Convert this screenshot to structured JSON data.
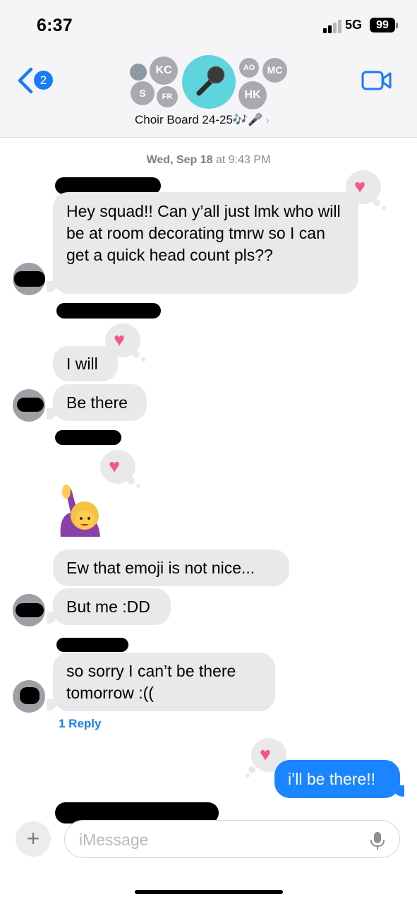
{
  "status_bar": {
    "time": "6:37",
    "network": "5G",
    "battery": "99"
  },
  "nav": {
    "back_badge": "2",
    "group_name": "Choir Board 24-25🎶🎤",
    "chevron": "›",
    "avatars": {
      "kc": "KC",
      "s": "S",
      "fr": "FR",
      "ao": "AO",
      "mc": "MC",
      "hk": "HK"
    }
  },
  "conversation": {
    "timestamp_day": "Wed, Sep 18",
    "timestamp_time": "at 9:43 PM",
    "messages": [
      {
        "text": "Hey squad!! Can y’all just lmk who will be at room decorating tmrw so I can get a quick head count pls??"
      },
      {
        "text": "I will"
      },
      {
        "text": "Be there"
      },
      {
        "text": "🙋‍♀️"
      },
      {
        "text": "Ew that emoji is not nice..."
      },
      {
        "text": "But me :DD"
      },
      {
        "text": "so sorry I can’t be there tomorrow :(("
      },
      {
        "text": "i’ll be there!!"
      }
    ],
    "reply_link": "1 Reply",
    "reaction": "♥"
  },
  "composer": {
    "plus": "+",
    "placeholder": "iMessage"
  },
  "colors": {
    "bubble_in": "#e9e9eb",
    "bubble_out": "#1a85ff",
    "accent": "#1a7cf5",
    "heart": "#f2568d"
  },
  "icons": [
    "back-chevron-icon",
    "video-camera-icon",
    "microphone-icon",
    "plus-icon",
    "heart-icon"
  ]
}
